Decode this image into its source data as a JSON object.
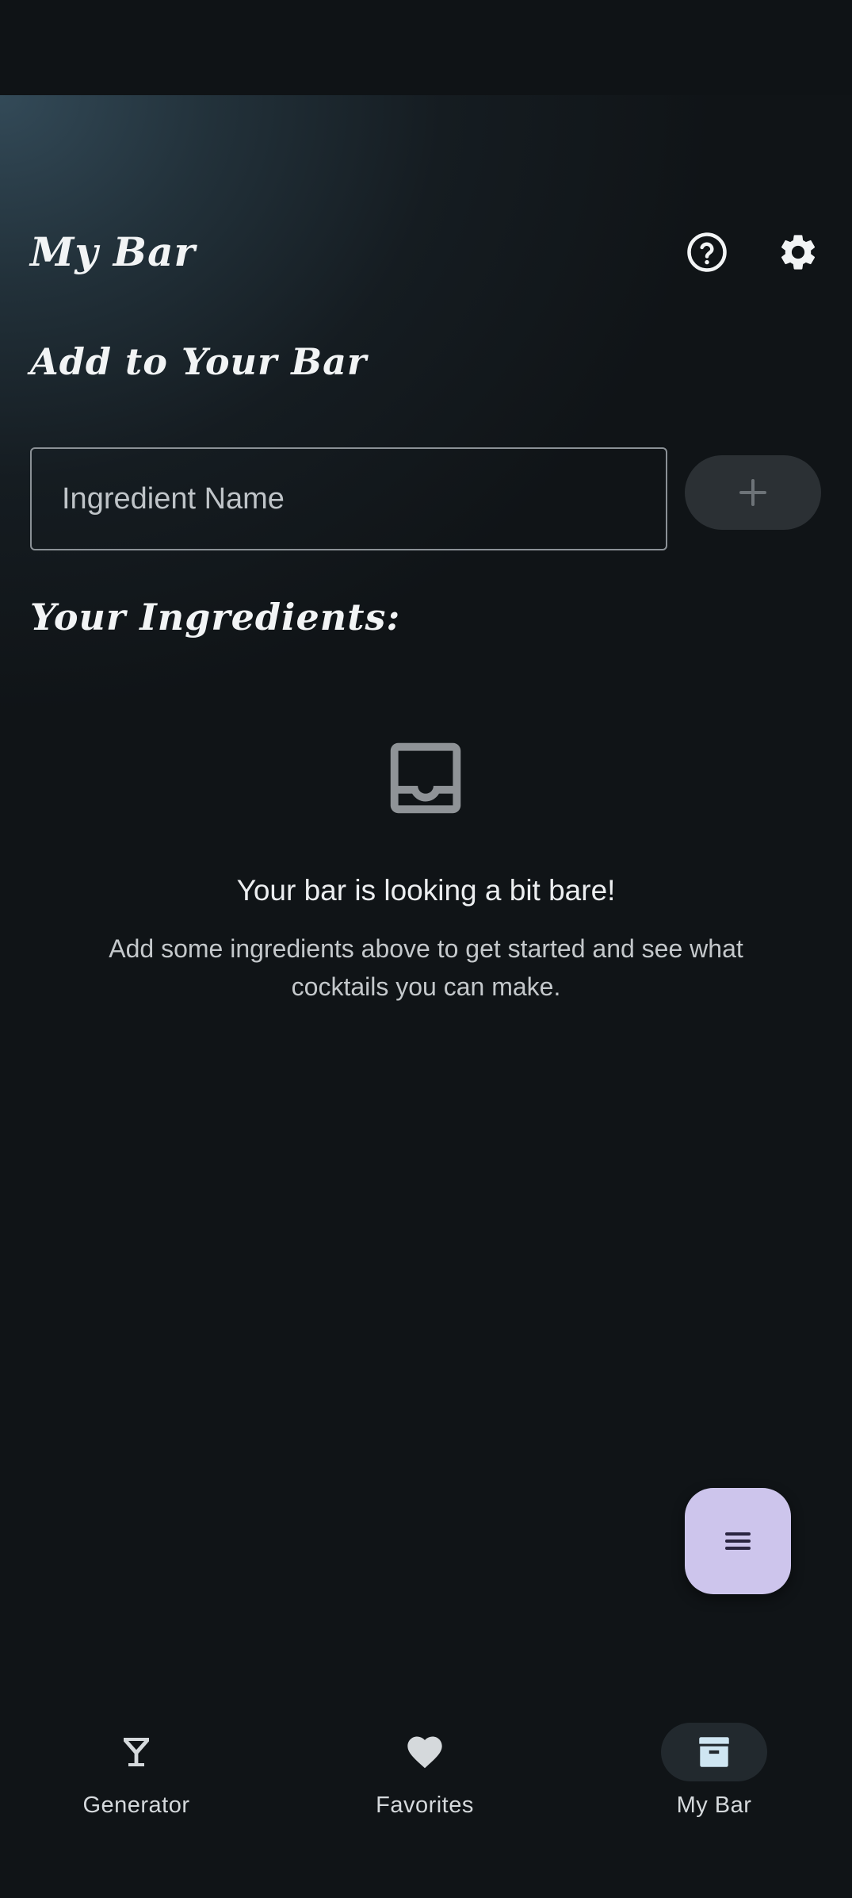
{
  "header": {
    "title": "My Bar",
    "help_icon": "help-circle-icon",
    "settings_icon": "gear-icon"
  },
  "add_section": {
    "title": "Add to Your Bar",
    "input_placeholder": "Ingredient Name",
    "input_value": "",
    "add_icon": "plus-icon"
  },
  "ingredients_section": {
    "title": "Your Ingredients:",
    "empty_icon": "inbox-tray-icon",
    "empty_title": "Your bar is looking a bit bare!",
    "empty_description": "Add some ingredients above to get started and see what cocktails you can make."
  },
  "fab": {
    "icon": "menu-icon"
  },
  "bottom_nav": {
    "items": [
      {
        "label": "Generator",
        "icon": "cocktail-glass-icon",
        "active": false
      },
      {
        "label": "Favorites",
        "icon": "heart-icon",
        "active": false
      },
      {
        "label": "My Bar",
        "icon": "archive-box-icon",
        "active": true
      }
    ]
  },
  "colors": {
    "background": "#101417",
    "accent_fab": "#cdc5ec",
    "active_nav_pill": "#22292e",
    "text_primary": "#eceef0",
    "text_secondary": "#c4c8cb"
  }
}
